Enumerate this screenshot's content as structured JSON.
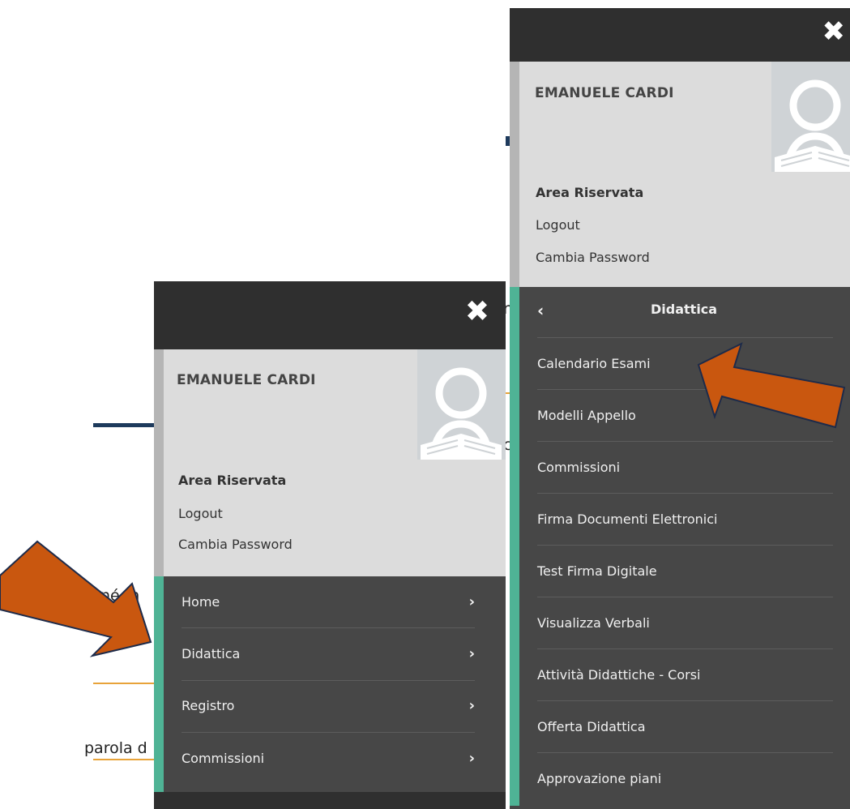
{
  "background_fragments": {
    "text_1": "né m",
    "text_2": "parola d",
    "text_3": "h",
    "text_4": "c",
    "text_5": "n"
  },
  "left_panel": {
    "close_label": "✖",
    "user_name": "EMANUELE CARDI",
    "area_label": "Area Riservata",
    "logout_label": "Logout",
    "change_password_label": "Cambia Password",
    "menu_items": [
      {
        "label": "Home"
      },
      {
        "label": "Didattica"
      },
      {
        "label": "Registro"
      },
      {
        "label": "Commissioni"
      }
    ],
    "chevron": "›"
  },
  "right_panel": {
    "close_label": "✖",
    "user_name": "EMANUELE CARDI",
    "area_label": "Area Riservata",
    "logout_label": "Logout",
    "change_password_label": "Cambia Password",
    "back_chevron": "‹",
    "submenu_title": "Didattica",
    "submenu_items": [
      {
        "label": "Calendario Esami"
      },
      {
        "label": "Modelli Appello"
      },
      {
        "label": "Commissioni"
      },
      {
        "label": "Firma Documenti Elettronici"
      },
      {
        "label": "Test Firma Digitale"
      },
      {
        "label": "Visualizza Verbali"
      },
      {
        "label": "Attività Didattiche - Corsi"
      },
      {
        "label": "Offerta Didattica"
      },
      {
        "label": "Approvazione piani"
      }
    ]
  },
  "colors": {
    "topbar": "#2f2f2f",
    "profile_bg": "#dcdcdc",
    "menu_bg": "#474747",
    "accent_teal": "#4fb395",
    "arrow_fill": "#c9570f",
    "arrow_stroke": "#1d2b4a"
  },
  "icons": {
    "close": "close-icon",
    "avatar": "user-reading-avatar-icon",
    "chevron": "chevron-right-icon",
    "back": "chevron-left-icon",
    "annotation": "orange-arrow-annotation"
  }
}
